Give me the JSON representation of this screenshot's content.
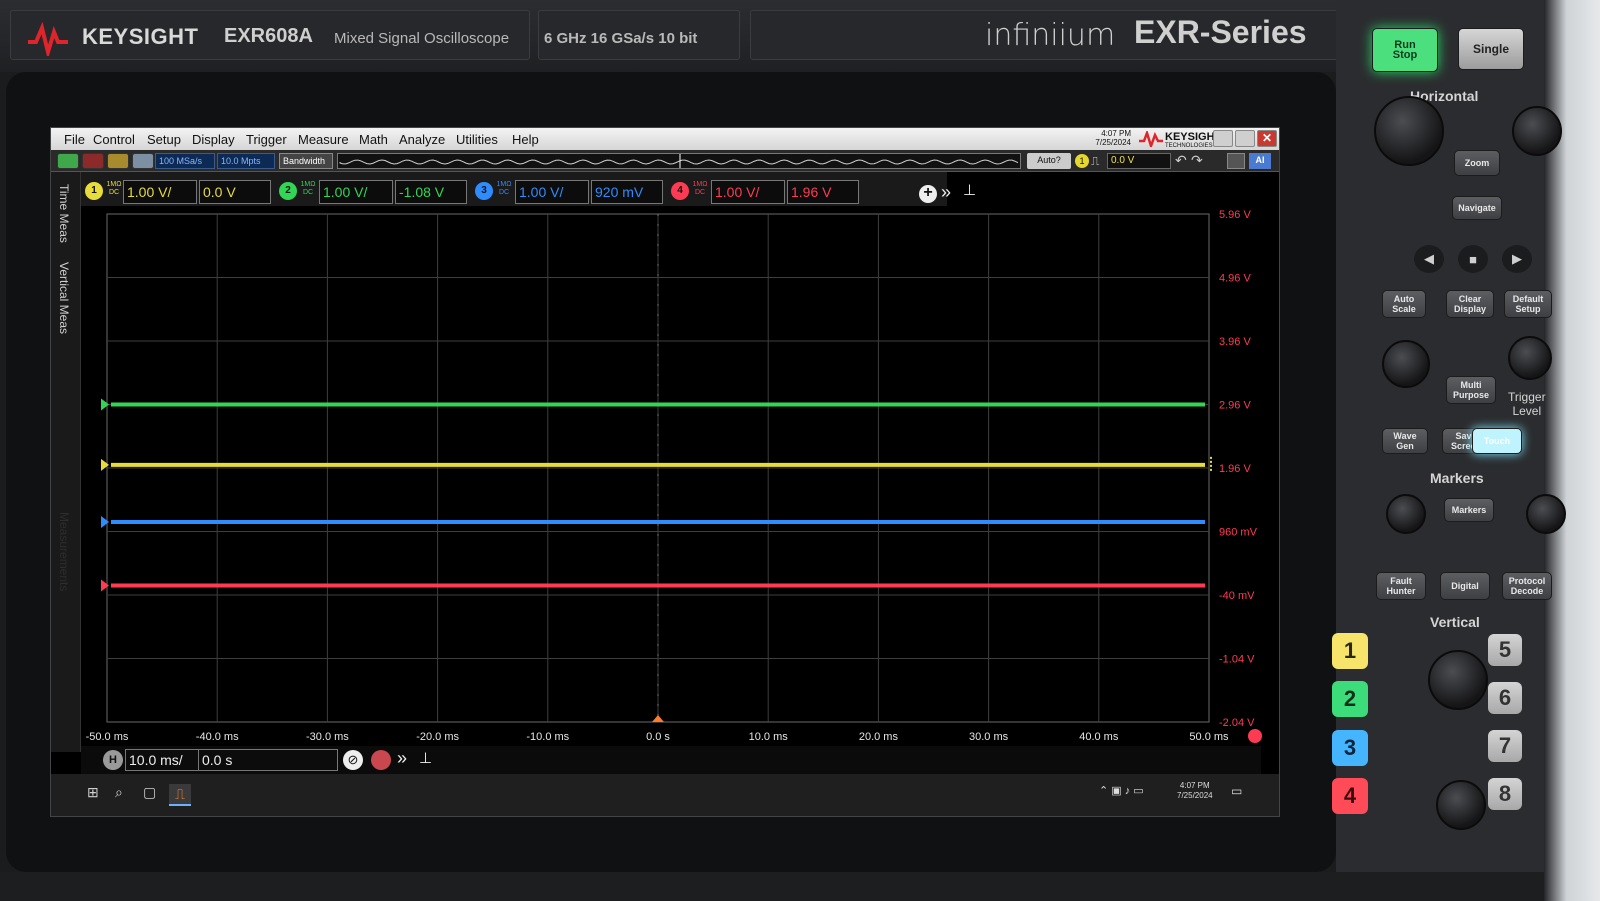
{
  "instrument": {
    "brand": "KEYSIGHT",
    "model": "EXR608A",
    "description": "Mixed Signal Oscilloscope",
    "spec": "6 GHz  16 GSa/s  10 bit",
    "family": "infiniium",
    "series": "EXR-Series"
  },
  "menu": {
    "items": [
      "File",
      "Control",
      "Setup",
      "Display",
      "Trigger",
      "Measure",
      "Math",
      "Analyze",
      "Utilities",
      "Help"
    ],
    "time": "4:07 PM",
    "date": "7/25/2024",
    "brand": "KEYSIGHT",
    "brand_sub": "TECHNOLOGIES"
  },
  "toolbar": {
    "sample_rate": "100 MSa/s",
    "memory_depth": "10.0 Mpts",
    "bandwidth_label": "Bandwidth",
    "trigger_mode": "Auto?",
    "trigger_source": "1",
    "trigger_level": "0.0 V"
  },
  "side_tabs": [
    "Time Meas",
    "Vertical Meas",
    "Measurements"
  ],
  "channels": [
    {
      "num": "1",
      "coupling": "1MΩ DC",
      "scale": "1.00 V/",
      "offset": "0.0 V",
      "color": "#e8dc3a"
    },
    {
      "num": "2",
      "coupling": "1MΩ DC",
      "scale": "1.00 V/",
      "offset": "-1.08 V",
      "color": "#31d655"
    },
    {
      "num": "3",
      "coupling": "1MΩ DC",
      "scale": "1.00 V/",
      "offset": "920 mV",
      "color": "#2f8cff"
    },
    {
      "num": "4",
      "coupling": "1MΩ DC",
      "scale": "1.00 V/",
      "offset": "1.96 V",
      "color": "#ff3b53"
    }
  ],
  "grid": {
    "y_labels": [
      "5.96 V",
      "4.96 V",
      "3.96 V",
      "2.96 V",
      "1.96 V",
      "960 mV",
      "-40 mV",
      "-1.04 V",
      "-2.04 V"
    ],
    "x_labels": [
      "-50.0 ms",
      "-40.0 ms",
      "-30.0 ms",
      "-20.0 ms",
      "-10.0 ms",
      "0.0 s",
      "10.0 ms",
      "20.0 ms",
      "30.0 ms",
      "40.0 ms",
      "50.0 ms"
    ],
    "y_label_color": "#ff3b53"
  },
  "chart_data": {
    "type": "line",
    "x": [
      -50,
      50
    ],
    "series": [],
    "xlim": [
      -50,
      50
    ],
    "ylim": [
      -2.04,
      5.96
    ],
    "traces": [
      {
        "channel": "2",
        "level_div": 3.0,
        "color": "#31d655"
      },
      {
        "channel": "1",
        "level_div": 3.95,
        "color": "#e8dc3a"
      },
      {
        "channel": "3",
        "level_div": 4.85,
        "color": "#2f8cff"
      },
      {
        "channel": "4",
        "level_div": 5.85,
        "color": "#ff3b53"
      }
    ]
  },
  "horizontal": {
    "scale": "10.0 ms/",
    "position": "0.0 s",
    "icon": "H"
  },
  "taskbar": {
    "time": "4:07 PM",
    "date": "7/25/2024"
  },
  "front_panel": {
    "run_stop": "Run\nStop",
    "single": "Single",
    "horizontal_label": "Horizontal",
    "zoom": "Zoom",
    "navigate": "Navigate",
    "auto_scale": "Auto\nScale",
    "clear_display": "Clear\nDisplay",
    "default_setup": "Default\nSetup",
    "multi_purpose": "Multi\nPurpose",
    "trigger_level": "Trigger\nLevel",
    "wave_gen": "Wave\nGen",
    "save_screen": "Save\nScreen",
    "touch": "Touch",
    "markers_label": "Markers",
    "markers_btn": "Markers",
    "fault_hunter": "Fault\nHunter",
    "digital": "Digital",
    "protocol_decode": "Protocol\nDecode",
    "vertical_label": "Vertical",
    "ch_buttons": [
      "1",
      "2",
      "3",
      "4",
      "5",
      "6",
      "7",
      "8"
    ]
  }
}
